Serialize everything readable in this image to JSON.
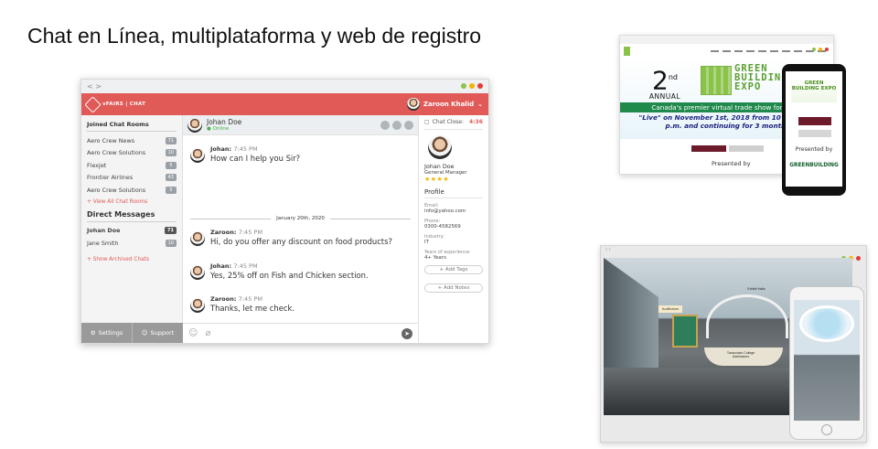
{
  "slide": {
    "title": "Chat en Línea, multiplataforma y web de registro"
  },
  "chat": {
    "window_controls": "< >",
    "app_name": "vFAIRS | CHAT",
    "current_user": "Zaroon Khalid",
    "sidebar": {
      "joined_header": "Joined Chat Rooms",
      "rooms": [
        {
          "name": "Aero Crew News",
          "count": "71"
        },
        {
          "name": "Aero Crew Solutions",
          "count": "10"
        },
        {
          "name": "Flexjet",
          "count": "5"
        },
        {
          "name": "Frontier Airlines",
          "count": "43"
        },
        {
          "name": "Aero Crew Solutions",
          "count": "5"
        }
      ],
      "view_all": "+ View All Chat Rooms",
      "direct_header": "Direct Messages",
      "direct": [
        {
          "name": "Johan Doe",
          "count": "71"
        },
        {
          "name": "Jane Smith",
          "count": "10"
        }
      ],
      "show_archived": "+ Show Archived Chats",
      "settings": "Settings",
      "support": "Support"
    },
    "conversation": {
      "contact": "Johan Doe",
      "status": "Online",
      "date_separator": "January 20th, 2020",
      "messages": [
        {
          "sender": "Johan:",
          "time": "7:45 PM",
          "text": "How can I help you Sir?"
        },
        {
          "sender": "Zaroon:",
          "time": "7:45 PM",
          "text": "Hi, do you offer any discount on food products?"
        },
        {
          "sender": "Johan:",
          "time": "7:45 PM",
          "text": "Yes, 25% off on Fish and Chicken section."
        },
        {
          "sender": "Zaroon:",
          "time": "7:45 PM",
          "text": "Thanks, let me check."
        }
      ]
    },
    "profile": {
      "chat_close_label": "Chat Close:",
      "chat_close_time": "4:36",
      "name": "Johan Doe",
      "role": "General Manager",
      "rating_stars": "★★★★",
      "section_title": "Profile",
      "fields": [
        {
          "label": "Email:",
          "value": "info@yahoo.com"
        },
        {
          "label": "Phone:",
          "value": "0300-4582569"
        },
        {
          "label": "Industry:",
          "value": "IT"
        },
        {
          "label": "Years of experience:",
          "value": "4+ Years"
        }
      ],
      "add_tags": "+ Add Tags",
      "add_notes": "+ Add Notes"
    }
  },
  "registration_site": {
    "ordinal_number": "2",
    "ordinal_suffix": "nd",
    "annual": "ANNUAL",
    "logo_text": "GREEN BUILDING EXPO",
    "banner": "Canada's premier virtual trade show for green",
    "live_text": "\"Live\" on November 1st, 2018 from 10 a.m. to 6 p.m. and continuing for 3 months",
    "presented_by": "Presented by",
    "phone_presented_by": "Presented by",
    "phone_sponsor": "GREENBUILDING"
  },
  "virtual_expo": {
    "booth_sign": "Auditorium",
    "hall_sign": "Exhibit Halls",
    "college_sign": "Tocaccolon College Admissions"
  },
  "colors": {
    "chat_red": "#e05a57",
    "green_banner": "#1f8a4c",
    "dot_green": "#8bc34a",
    "dot_yellow": "#f5b301",
    "dot_red": "#e53935"
  }
}
